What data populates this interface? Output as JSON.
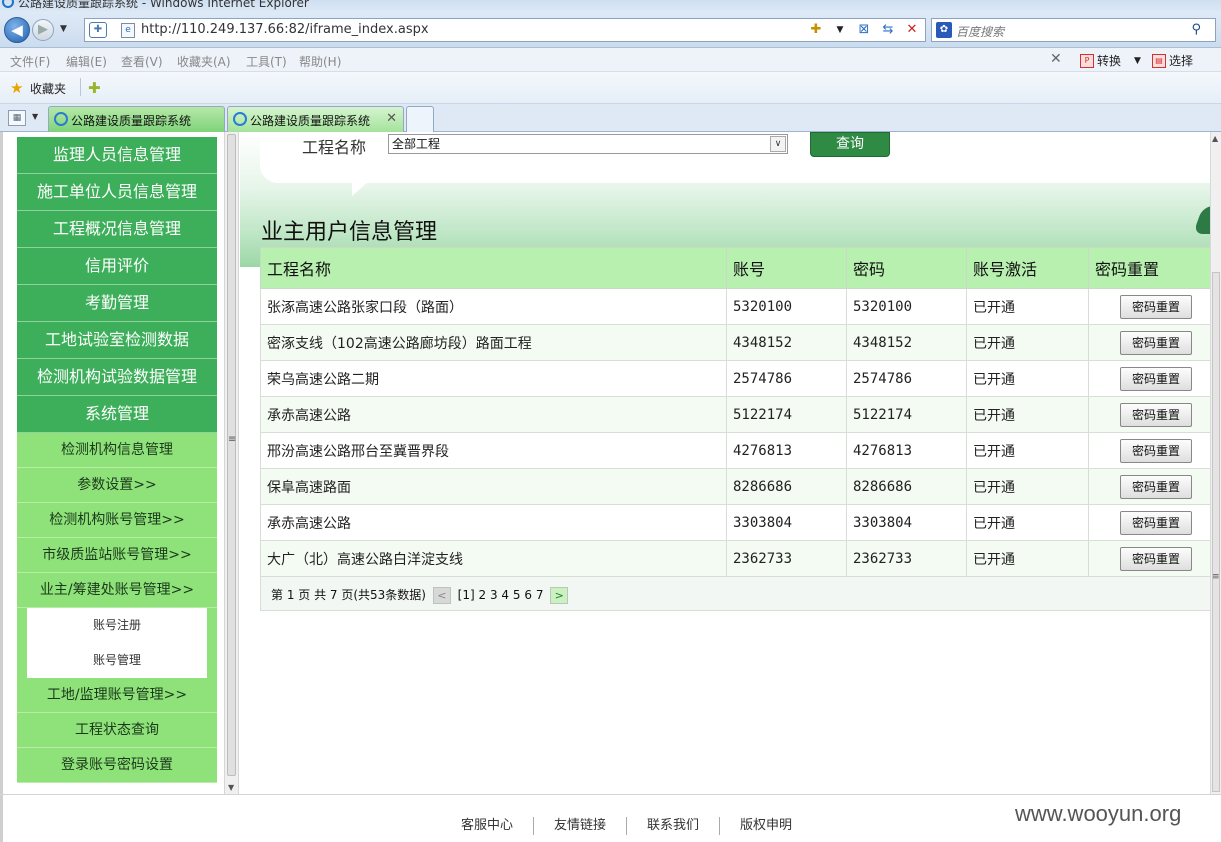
{
  "browser": {
    "title": "公路建设质量跟踪系统 - Windows Internet Explorer",
    "url": "http://110.249.137.66:82/iframe_index.aspx",
    "search_placeholder": "百度搜索",
    "menu": [
      "文件(F)",
      "编辑(E)",
      "查看(V)",
      "收藏夹(A)",
      "工具(T)",
      "帮助(H)"
    ],
    "tools": {
      "convert": "转换",
      "select": "选择"
    },
    "favorites_label": "收藏夹",
    "tabs": [
      {
        "label": "公路建设质量跟踪系统"
      },
      {
        "label": "公路建设质量跟踪系统"
      }
    ]
  },
  "sidebar": {
    "main_items": [
      "监理人员信息管理",
      "施工单位人员信息管理",
      "工程概况信息管理",
      "信用评价",
      "考勤管理",
      "工地试验室检测数据",
      "检测机构试验数据管理",
      "系统管理"
    ],
    "sub_items_top": [
      "检测机构信息管理",
      "参数设置>>",
      "检测机构账号管理>>",
      "市级质监站账号管理>>",
      "业主/筹建处账号管理>>"
    ],
    "sub_sub_items": [
      "账号注册",
      "账号管理"
    ],
    "sub_items_bottom": [
      "工地/监理账号管理>>",
      "工程状态查询",
      "登录账号密码设置"
    ]
  },
  "filter": {
    "project_label": "工程名称",
    "project_value": "全部工程",
    "query_button": "查询"
  },
  "page_title": "业主用户信息管理",
  "table": {
    "headers": [
      "工程名称",
      "账号",
      "密码",
      "账号激活",
      "密码重置"
    ],
    "reset_label": "密码重置",
    "rows": [
      {
        "name": "张涿高速公路张家口段（路面）",
        "account": "5320100",
        "password": "5320100",
        "status": "已开通"
      },
      {
        "name": "密涿支线（102高速公路廊坊段）路面工程",
        "account": "4348152",
        "password": "4348152",
        "status": "已开通"
      },
      {
        "name": "荣乌高速公路二期",
        "account": "2574786",
        "password": "2574786",
        "status": "已开通"
      },
      {
        "name": "承赤高速公路",
        "account": "5122174",
        "password": "5122174",
        "status": "已开通"
      },
      {
        "name": "邢汾高速公路邢台至冀晋界段",
        "account": "4276813",
        "password": "4276813",
        "status": "已开通"
      },
      {
        "name": "保阜高速路面",
        "account": "8286686",
        "password": "8286686",
        "status": "已开通"
      },
      {
        "name": "承赤高速公路",
        "account": "3303804",
        "password": "3303804",
        "status": "已开通"
      },
      {
        "name": "大广（北）高速公路白洋淀支线",
        "account": "2362733",
        "password": "2362733",
        "status": "已开通"
      }
    ]
  },
  "pager": {
    "summary": "第 1 页 共 7 页(共53条数据)",
    "current": "[1]",
    "pages": [
      "2",
      "3",
      "4",
      "5",
      "6",
      "7"
    ],
    "prev": "<",
    "next": ">"
  },
  "footer": {
    "links": [
      "客服中心",
      "友情链接",
      "联系我们",
      "版权申明"
    ],
    "watermark": "www.wooyun.org"
  }
}
